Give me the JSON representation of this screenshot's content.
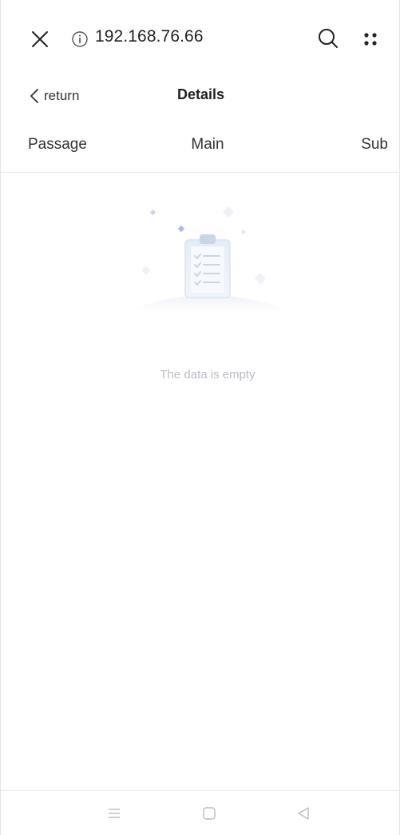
{
  "browser": {
    "url": "192.168.76.66",
    "icons": [
      "close-icon",
      "info-icon",
      "search-icon",
      "more-dots-icon"
    ]
  },
  "header": {
    "back_label": "return",
    "title": "Details"
  },
  "tabs": [
    {
      "label": "Passage"
    },
    {
      "label": "Main"
    },
    {
      "label": "Sub"
    }
  ],
  "empty_state": {
    "message": "The data is empty",
    "illustration": "clipboard-checklist-icon"
  },
  "system_nav": {
    "icons": [
      "menu-lines-icon",
      "home-square-icon",
      "back-triangle-icon"
    ]
  },
  "colors": {
    "text_primary": "#222222",
    "empty_text": "#b8bcc4",
    "illustration_accent": "#c9d6e8",
    "divider": "#ececec"
  }
}
